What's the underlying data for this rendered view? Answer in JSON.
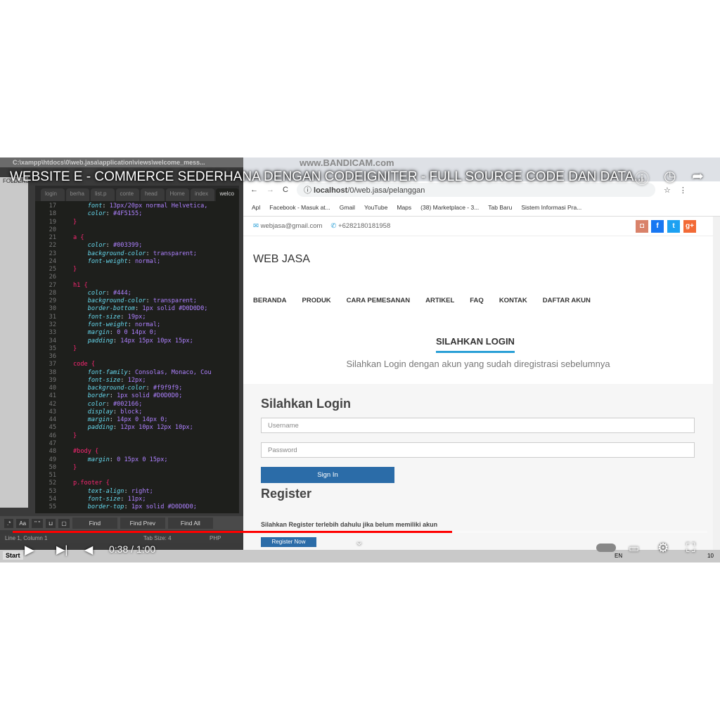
{
  "video": {
    "title": "WEBSITE E - COMMERCE SEDERHANA DENGAN CODEIGNITER - FULL SOURCE CODE DAN DATA...",
    "time": "0:38 / 1:00",
    "progress": 0.633,
    "accent": "#ff0000"
  },
  "editor": {
    "window_title": "C:\\xampp\\htdocs\\0\\web.jasa\\application\\views\\welcome_mess...",
    "folders_label": "FOLDERS",
    "tabs": [
      "login",
      "berha",
      "list.p",
      "conte",
      "head",
      "Home",
      "index",
      "welco"
    ],
    "lines": [
      [
        "17",
        "",
        "font",
        "13px/20px normal Helvetica,"
      ],
      [
        "18",
        "",
        "color",
        "#4F5155;"
      ],
      [
        "19",
        "}",
        "",
        ""
      ],
      [
        "20",
        "",
        "",
        ""
      ],
      [
        "21",
        "a {",
        "",
        ""
      ],
      [
        "22",
        "",
        "color",
        "#003399;"
      ],
      [
        "23",
        "",
        "background-color",
        "transparent;"
      ],
      [
        "24",
        "",
        "font-weight",
        "normal;"
      ],
      [
        "25",
        "}",
        "",
        ""
      ],
      [
        "26",
        "",
        "",
        ""
      ],
      [
        "27",
        "h1 {",
        "",
        ""
      ],
      [
        "28",
        "",
        "color",
        "#444;"
      ],
      [
        "29",
        "",
        "background-color",
        "transparent;"
      ],
      [
        "30",
        "",
        "border-bottom",
        "1px solid #D0D0D0;"
      ],
      [
        "31",
        "",
        "font-size",
        "19px;"
      ],
      [
        "32",
        "",
        "font-weight",
        "normal;"
      ],
      [
        "33",
        "",
        "margin",
        "0 0 14px 0;"
      ],
      [
        "34",
        "",
        "padding",
        "14px 15px 10px 15px;"
      ],
      [
        "35",
        "}",
        "",
        ""
      ],
      [
        "36",
        "",
        "",
        ""
      ],
      [
        "37",
        "code {",
        "",
        ""
      ],
      [
        "38",
        "",
        "font-family",
        "Consolas, Monaco, Cou"
      ],
      [
        "39",
        "",
        "font-size",
        "12px;"
      ],
      [
        "40",
        "",
        "background-color",
        "#f9f9f9;"
      ],
      [
        "41",
        "",
        "border",
        "1px solid #D0D0D0;"
      ],
      [
        "42",
        "",
        "color",
        "#002166;"
      ],
      [
        "43",
        "",
        "display",
        "block;"
      ],
      [
        "44",
        "",
        "margin",
        "14px 0 14px 0;"
      ],
      [
        "45",
        "",
        "padding",
        "12px 10px 12px 10px;"
      ],
      [
        "46",
        "}",
        "",
        ""
      ],
      [
        "47",
        "",
        "",
        ""
      ],
      [
        "48",
        "#body {",
        "",
        ""
      ],
      [
        "49",
        "",
        "margin",
        "0 15px 0 15px;"
      ],
      [
        "50",
        "}",
        "",
        ""
      ],
      [
        "51",
        "",
        "",
        ""
      ],
      [
        "52",
        "p.footer {",
        "",
        ""
      ],
      [
        "53",
        "",
        "text-align",
        "right;"
      ],
      [
        "54",
        "",
        "font-size",
        "11px;"
      ],
      [
        "55",
        "",
        "border-top",
        "1px solid #D0D0D0;"
      ]
    ],
    "find_toggles": [
      ".*",
      "Aa",
      "\" \""
    ],
    "find": "Find",
    "find_prev": "Find Prev",
    "find_all": "Find All",
    "status_pos": "Line 1, Column 1",
    "status_tab": "Tab Size: 4",
    "status_syntax": "PHP"
  },
  "browser": {
    "watermark": "www.BANDICAM.com",
    "url_host": "localhost",
    "url_path": "/0/web.jasa/pelanggan",
    "bookmarks": [
      "Apl",
      "Facebook - Masuk at...",
      "Gmail",
      "YouTube",
      "Maps",
      "(38) Marketplace - 3...",
      "Tab Baru",
      "Sistem Informasi Pra..."
    ],
    "email": "webjasa@gmail.com",
    "phone": "+6282180181958",
    "brand": "WEB JASA",
    "nav": [
      "BERANDA",
      "PRODUK",
      "CARA PEMESANAN",
      "ARTIKEL",
      "FAQ",
      "KONTAK",
      "DAFTAR AKUN"
    ],
    "login_tab": "SILAHKAN LOGIN",
    "login_sub": "Silahkan Login dengan akun yang sudah diregistrasi sebelumnya",
    "login_heading": "Silahkan Login",
    "username_ph": "Username",
    "password_ph": "Password",
    "signin": "Sign In",
    "register_heading": "Register",
    "register_text": "Silahkan Register terlebih dahulu jika belum memiliki akun",
    "register_btn": "Register Now"
  },
  "taskbar": {
    "start": "Start",
    "lang": "EN",
    "clock": "10"
  }
}
